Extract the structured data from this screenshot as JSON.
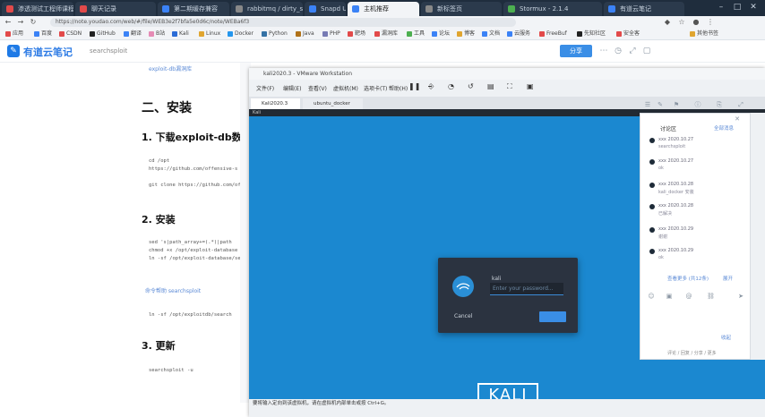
{
  "browser": {
    "tabs": [
      {
        "label": "渗透测试工程师课程",
        "color": "#e24a4a"
      },
      {
        "label": "聊天记录",
        "color": "#e24a4a"
      },
      {
        "label": "第二期缓存兼容",
        "color": "#3b82f6"
      },
      {
        "label": "rabbitmq / dirty_soc",
        "color": "#888888"
      },
      {
        "label": "Snapd Ubu",
        "color": "#3b82f6"
      },
      {
        "label": "主机推荐",
        "color": "#3b82f6"
      },
      {
        "label": "新标签页",
        "color": "#888888"
      },
      {
        "label": "Stormux - 2.1.4",
        "color": "#4caf50"
      },
      {
        "label": "有道云笔记",
        "color": "#3b82f6"
      }
    ],
    "url": "https://note.youdao.com/web/#/file/WEB3e2f7bfa5e0d6c/note/WEBa6f3",
    "bookmarks": [
      "应用",
      "百度",
      "CSDN",
      "GitHub",
      "翻译",
      "B站",
      "Kali",
      "Linux",
      "Docker",
      "Python",
      "Java",
      "PHP",
      "靶场",
      "漏洞库",
      "工具",
      "论坛",
      "博客",
      "文档",
      "云服务",
      "FreeBuf",
      "先知社区",
      "安全客",
      "其他书签"
    ]
  },
  "app": {
    "name": "有道云笔记",
    "doc_name": "searchsploit",
    "share_label": "分享",
    "logo_color": "#1e7ae6"
  },
  "note": {
    "top_link": "exploit-db漏洞库",
    "h1": "二、安装",
    "s1_title": "1. 下载exploit-db数",
    "s1_code": "cd /opt\nhttps://github.com/offensive-s\n\ngit clone https://github.com/of",
    "s2_title": "2. 安装",
    "s2_code": "sed 's|path_array+=(.*)|path\nchmod +x /opt/exploit-database\nln -sf /opt/exploit-database/sea",
    "s2_link": "命令帮助 searchsploit",
    "s2_code2": "ln -sf /opt/exploitdb/search",
    "s3_title": "3. 更新",
    "s3_code": "searchsploit -u"
  },
  "vm": {
    "title": "kali2020.3 - VMware Workstation",
    "menu": [
      "文件(F)",
      "编辑(E)",
      "查看(V)",
      "虚拟机(M)",
      "选项卡(T)",
      "帮助(H)"
    ],
    "tabs": [
      "Kali2020.3",
      "ubuntu_docker"
    ],
    "screen_label": "Kali",
    "dialog": {
      "user": "kali",
      "placeholder": "Enter your password...",
      "cancel": "Cancel",
      "unlock": ""
    },
    "logo_text": "KALI",
    "status": "要将输入定向到该虚拟机，请在虚拟机内部单击或按 Ctrl+G。"
  },
  "side_panel": {
    "title": "讨论区",
    "title_right": "全部消息",
    "rows": [
      {
        "name": "xxx 2020.10.27",
        "sub": "searchsploit"
      },
      {
        "name": "xxx 2020.10.27",
        "sub": "ok"
      },
      {
        "name": "xxx 2020.10.28",
        "sub": "kali_docker 安装"
      },
      {
        "name": "xxx 2020.10.28",
        "sub": "已解决"
      },
      {
        "name": "xxx 2020.10.29",
        "sub": "谢谢"
      },
      {
        "name": "xxx 2020.10.29",
        "sub": "ok"
      }
    ],
    "more_link": "查看更多 (共12条)",
    "more_right": "展开",
    "footer_link": "收起",
    "footer_bottom": "评论 / 回复 / 分享 / 更多"
  },
  "colors": {
    "kali_blue": "#1b88d0",
    "accent": "#3a8ee6",
    "tabstrip": "#1f2d3d"
  }
}
